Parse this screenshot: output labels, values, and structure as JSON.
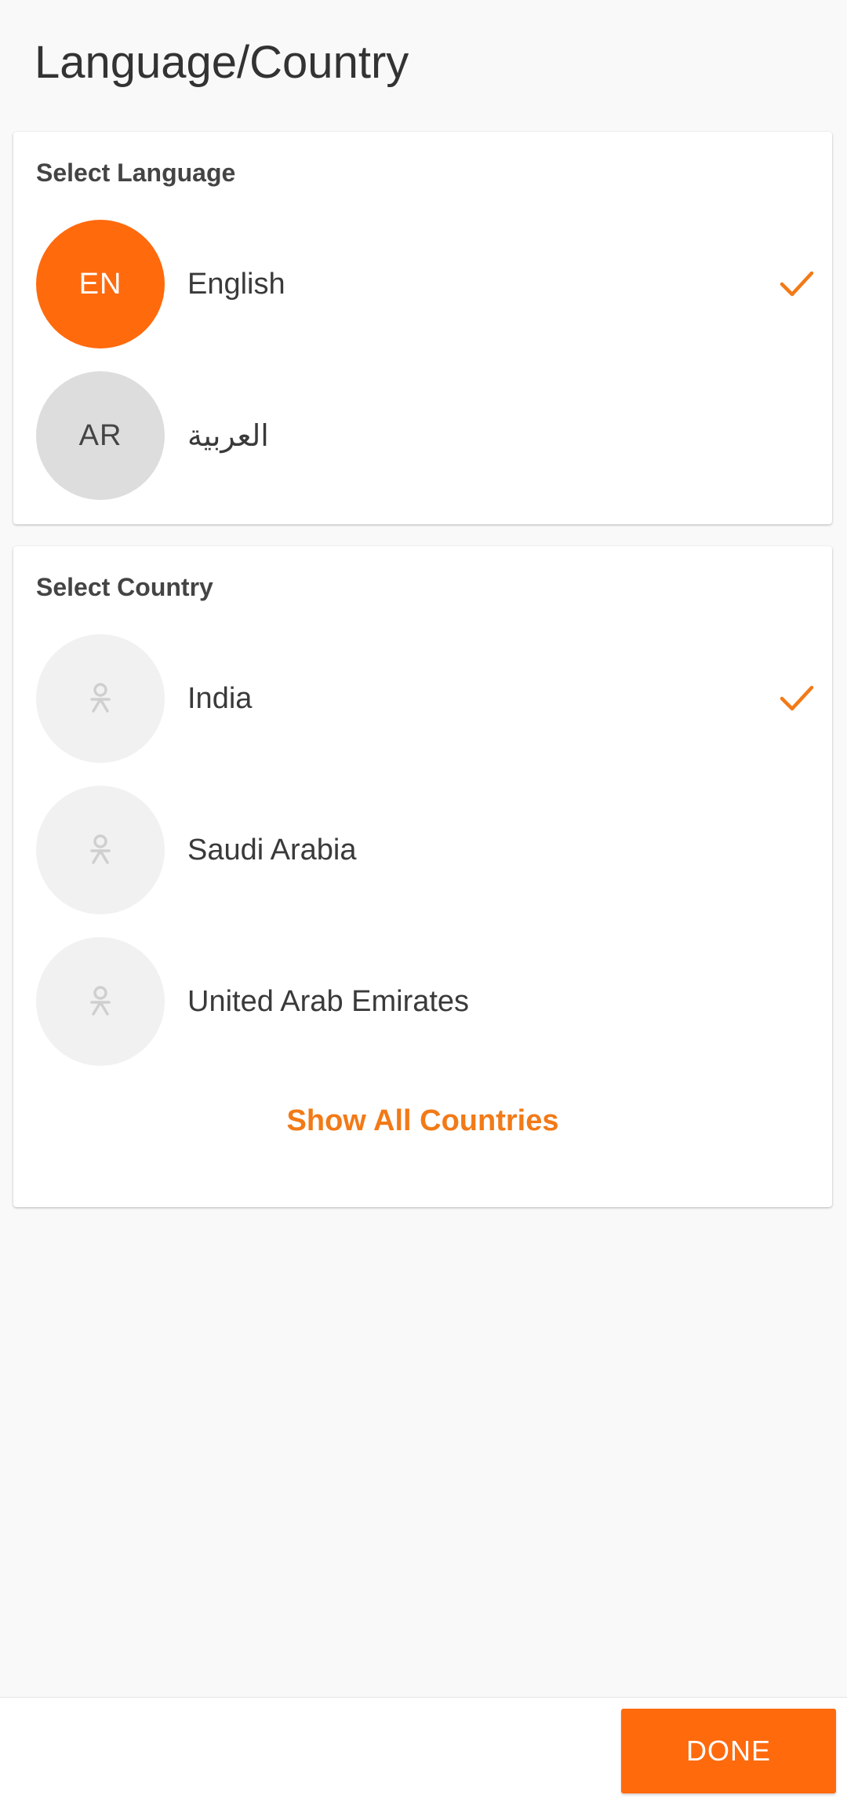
{
  "header": {
    "title": "Language/Country"
  },
  "language_section": {
    "title": "Select Language",
    "items": [
      {
        "code": "EN",
        "label": "English",
        "selected": true
      },
      {
        "code": "AR",
        "label": "العربية",
        "selected": false
      }
    ]
  },
  "country_section": {
    "title": "Select Country",
    "items": [
      {
        "label": "India",
        "selected": true,
        "icon": "flag-placeholder-icon"
      },
      {
        "label": "Saudi Arabia",
        "selected": false,
        "icon": "flag-placeholder-icon"
      },
      {
        "label": "United Arab Emirates",
        "selected": false,
        "icon": "flag-placeholder-icon"
      }
    ],
    "show_all_label": "Show All Countries"
  },
  "footer": {
    "done_label": "DONE"
  },
  "colors": {
    "accent": "#ff6a0d",
    "link": "#f27a17",
    "background": "#f9f9f9",
    "avatar_inactive": "#dddddd",
    "flag_placeholder": "#f1f1f1"
  }
}
